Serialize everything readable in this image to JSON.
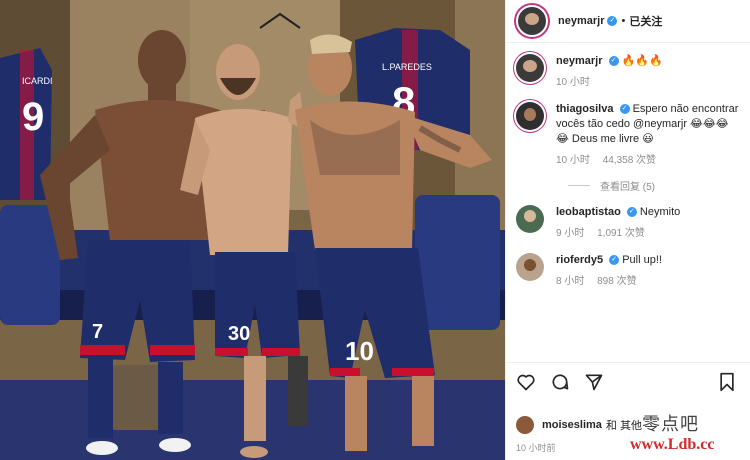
{
  "header": {
    "username": "neymarjr",
    "follow_state": "已关注",
    "dot": "•"
  },
  "caption": {
    "username": "neymarjr",
    "text": "🔥🔥🔥",
    "time": "10 小时"
  },
  "comments": [
    {
      "username": "thiagosilva",
      "text": "Espero não encontrar vocês tão cedo @neymarjr 😂😂😂😂 Deus me livre 😃",
      "time": "10 小时",
      "likes": "44,358 次赞",
      "replies": "查看回复 (5)"
    },
    {
      "username": "leobaptistao",
      "text": "Neymito",
      "time": "9 小时",
      "likes": "1,091 次赞"
    },
    {
      "username": "rioferdy5",
      "text": "Pull up!!",
      "time": "8 小时",
      "likes": "898 次赞"
    }
  ],
  "likes_line": {
    "username": "moiseslima",
    "text": "和 其他"
  },
  "posted_ago": "10 小时前",
  "watermark": {
    "line1": "零点吧",
    "line2": "www.Ldb.cc"
  },
  "jerseys": {
    "left": {
      "name": "ICARDI",
      "number": "9"
    },
    "right": {
      "name": "L.PAREDES",
      "number": "8"
    }
  },
  "players": [
    {
      "number": "7"
    },
    {
      "number": "30"
    },
    {
      "number": "10"
    }
  ],
  "icons": [
    "heart-icon",
    "comment-icon",
    "share-icon",
    "bookmark-icon",
    "verified-icon"
  ],
  "colors": {
    "accent": "#3897f0",
    "ring": "#c13584",
    "meta": "#8e8e8e",
    "psg_blue": "#1f2d6b",
    "psg_red": "#c8102e"
  }
}
